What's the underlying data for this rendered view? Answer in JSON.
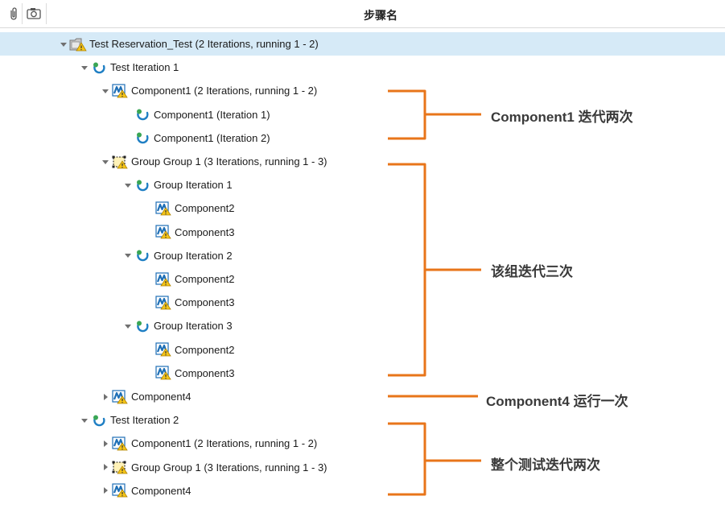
{
  "header": {
    "column_title": "步骤名",
    "attachment_icon": "paperclip-icon",
    "snapshot_icon": "camera-icon"
  },
  "tree": [
    {
      "label": "Test Reservation_Test (2 Iterations, running 1 - 2)",
      "icon": "test-folder-icon",
      "toggle": "expanded",
      "level": 0,
      "selected": true
    },
    {
      "label": "Test Iteration 1",
      "icon": "iteration-icon",
      "toggle": "expanded",
      "level": 1
    },
    {
      "label": "Component1 (2 Iterations, running 1 - 2)",
      "icon": "component-icon",
      "toggle": "expanded",
      "level": 2
    },
    {
      "label": "Component1 (Iteration 1)",
      "icon": "iteration-icon",
      "toggle": "none",
      "level": 3
    },
    {
      "label": "Component1 (Iteration 2)",
      "icon": "iteration-icon",
      "toggle": "none",
      "level": 3
    },
    {
      "label": "Group Group 1 (3 Iterations, running 1 - 3)",
      "icon": "group-icon",
      "toggle": "expanded",
      "level": 2
    },
    {
      "label": "Group Iteration 1",
      "icon": "iteration-icon",
      "toggle": "expanded",
      "level": 3
    },
    {
      "label": "Component2",
      "icon": "component-icon",
      "toggle": "none",
      "level": 4
    },
    {
      "label": "Component3",
      "icon": "component-icon",
      "toggle": "none",
      "level": 4
    },
    {
      "label": "Group Iteration 2",
      "icon": "iteration-icon",
      "toggle": "expanded",
      "level": 3
    },
    {
      "label": "Component2",
      "icon": "component-icon",
      "toggle": "none",
      "level": 4
    },
    {
      "label": "Component3",
      "icon": "component-icon",
      "toggle": "none",
      "level": 4
    },
    {
      "label": "Group Iteration 3",
      "icon": "iteration-icon",
      "toggle": "expanded",
      "level": 3
    },
    {
      "label": "Component2",
      "icon": "component-icon",
      "toggle": "none",
      "level": 4
    },
    {
      "label": "Component3",
      "icon": "component-icon",
      "toggle": "none",
      "level": 4
    },
    {
      "label": "Component4",
      "icon": "component-icon",
      "toggle": "collapsed",
      "level": 2
    },
    {
      "label": "Test Iteration 2",
      "icon": "iteration-icon",
      "toggle": "expanded",
      "level": 1
    },
    {
      "label": "Component1 (2 Iterations, running 1 - 2)",
      "icon": "component-icon",
      "toggle": "collapsed",
      "level": 2
    },
    {
      "label": "Group Group 1 (3 Iterations, running 1 - 3)",
      "icon": "group-icon",
      "toggle": "collapsed",
      "level": 2
    },
    {
      "label": "Component4",
      "icon": "component-icon",
      "toggle": "collapsed",
      "level": 2
    }
  ],
  "annotations": [
    {
      "text": "Component1 迭代两次"
    },
    {
      "text": "该组迭代三次"
    },
    {
      "text": "Component4 运行一次"
    },
    {
      "text": "整个测试迭代两次"
    }
  ],
  "colors": {
    "selection": "#d6eaf7",
    "annotation_bracket": "#e8751a",
    "iteration_green": "#3aa655",
    "iteration_blue": "#1f7fc4",
    "component_blue": "#1e6fb6",
    "warning_yellow": "#f5c518"
  }
}
